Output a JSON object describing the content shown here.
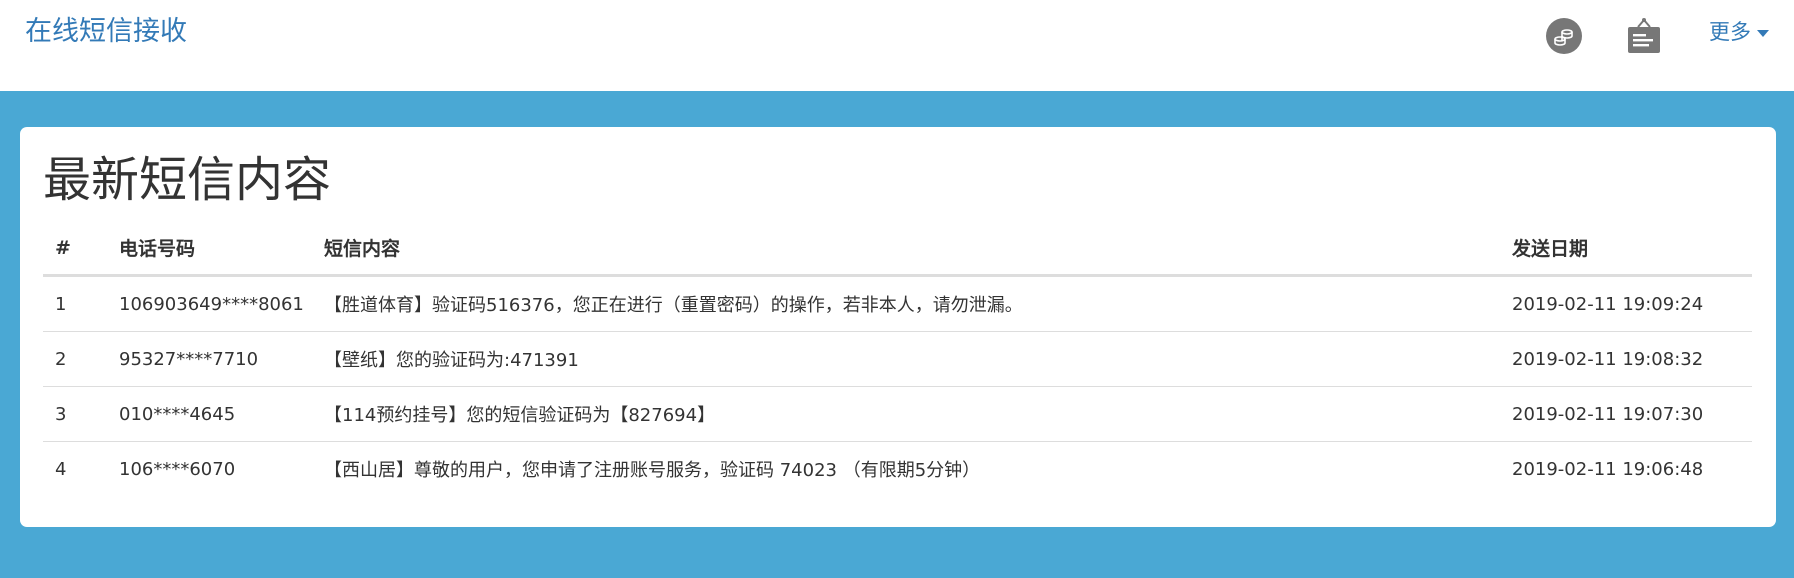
{
  "navbar": {
    "brand": "在线短信接收",
    "more_label": "更多",
    "icons": [
      "coins-icon",
      "signboard-icon"
    ]
  },
  "main": {
    "title": "最新短信内容",
    "table": {
      "headers": {
        "index": "#",
        "phone": "电话号码",
        "content": "短信内容",
        "date": "发送日期"
      },
      "rows": [
        {
          "index": "1",
          "phone": "106903649****8061",
          "content": "【胜道体育】验证码516376，您正在进行（重置密码）的操作，若非本人，请勿泄漏。",
          "date": "2019-02-11 19:09:24"
        },
        {
          "index": "2",
          "phone": "95327****7710",
          "content": "【壁纸】您的验证码为:471391",
          "date": "2019-02-11 19:08:32"
        },
        {
          "index": "3",
          "phone": "010****4645",
          "content": "【114预约挂号】您的短信验证码为【827694】",
          "date": "2019-02-11 19:07:30"
        },
        {
          "index": "4",
          "phone": "106****6070",
          "content": "【西山居】尊敬的用户，您申请了注册账号服务，验证码 74023 （有限期5分钟）",
          "date": "2019-02-11 19:06:48"
        }
      ]
    }
  },
  "colors": {
    "page_background": "#4aa8d4",
    "link": "#337ab7",
    "icon_gray": "#777777"
  }
}
